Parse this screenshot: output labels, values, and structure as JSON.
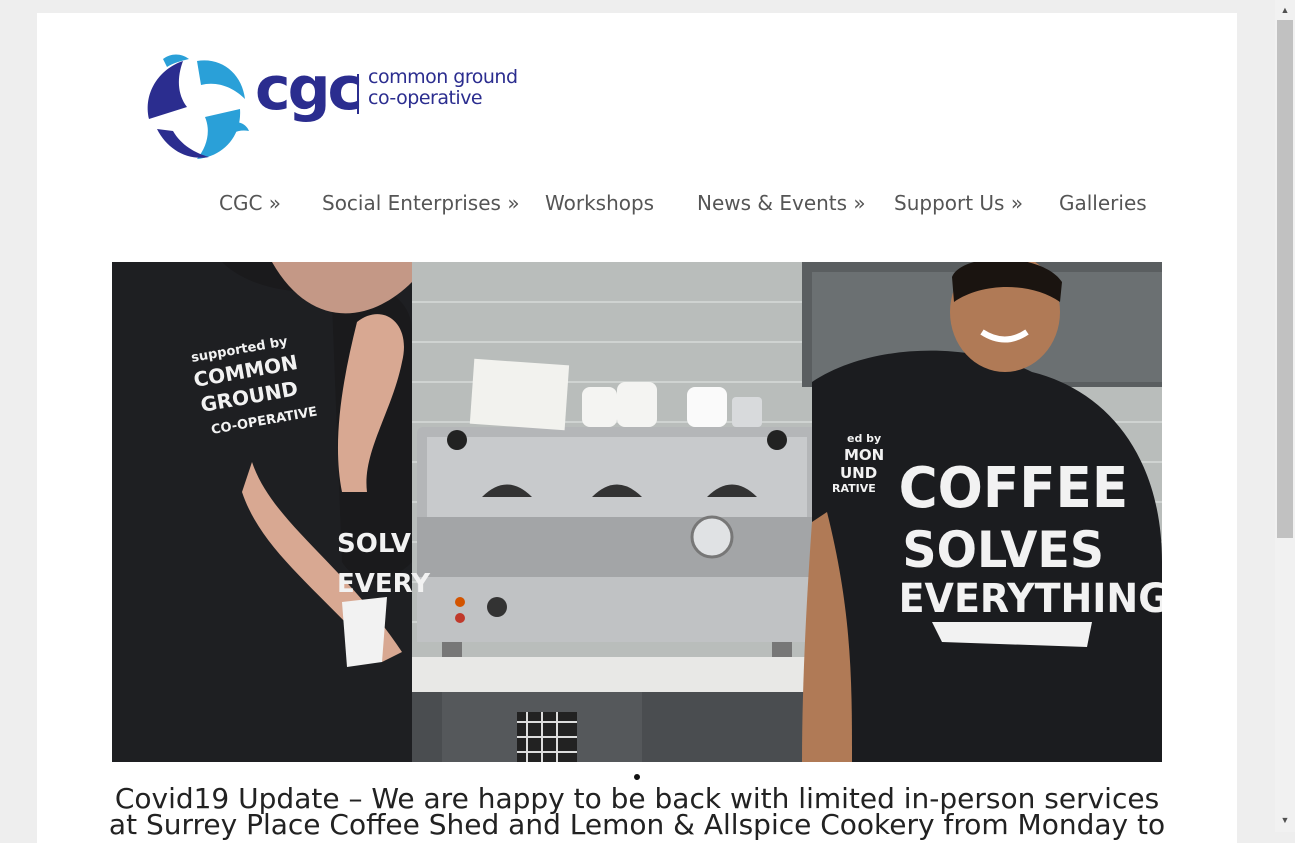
{
  "logo": {
    "brand": "cgc",
    "tagline_line1": "common ground",
    "tagline_line2": "co-operative",
    "brand_color": "#2b2d8f",
    "accent_color": "#2aa0d8"
  },
  "nav": {
    "items": [
      {
        "label": "CGC »"
      },
      {
        "label": "Social Enterprises »"
      },
      {
        "label": "Workshops"
      },
      {
        "label": "News & Events »"
      },
      {
        "label": "Support Us »"
      },
      {
        "label": "Galleries"
      }
    ]
  },
  "hero": {
    "left_shirt_sleeve": [
      "supported by",
      "COMMON",
      "GROUND",
      "CO-OPERATIVE"
    ],
    "right_shirt_front": [
      "COFFEE",
      "SOLVES",
      "EVERYTHING"
    ],
    "right_shirt_sleeve": [
      "ed by",
      "MON",
      "UND",
      "RATIVE"
    ],
    "left_shirt_front": [
      "SOLV",
      "EVERY"
    ]
  },
  "post": {
    "headline_line1": "Covid19 Update – We are happy to be back with limited in-person services",
    "headline_line2": "at Surrey Place Coffee Shed and Lemon & Allspice Cookery from Monday to"
  }
}
